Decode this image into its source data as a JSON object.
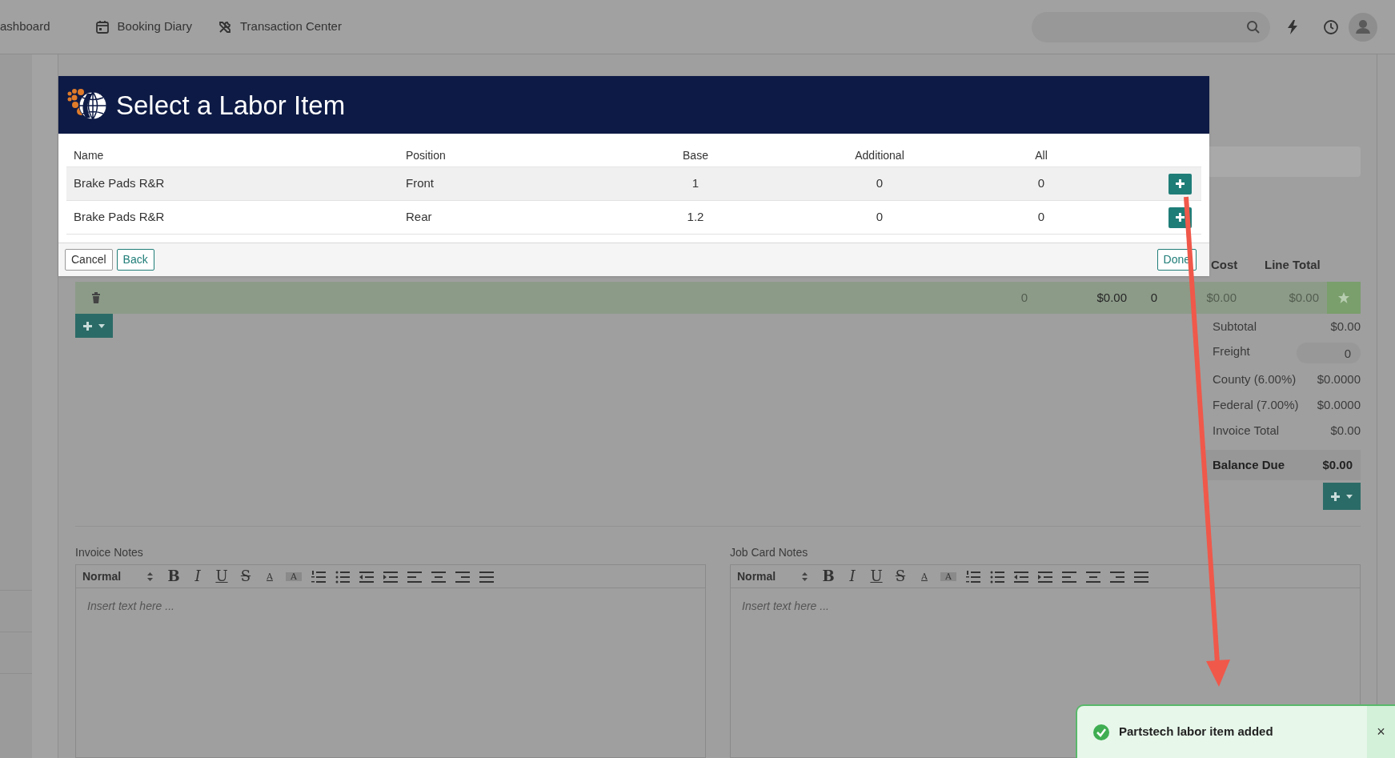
{
  "nav": {
    "items": [
      {
        "label": "ashboard"
      },
      {
        "label": "Booking Diary"
      },
      {
        "label": "Transaction Center"
      }
    ]
  },
  "modal": {
    "title": "Select a Labor Item",
    "columns": [
      "Name",
      "Position",
      "Base",
      "Additional",
      "All"
    ],
    "rows": [
      {
        "name": "Brake Pads R&R",
        "position": "Front",
        "base": "1",
        "additional": "0",
        "all": "0",
        "selected": true
      },
      {
        "name": "Brake Pads R&R",
        "position": "Rear",
        "base": "1.2",
        "additional": "0",
        "all": "0",
        "selected": false
      }
    ],
    "footer_buttons": [
      {
        "label": "Cancel",
        "kind": "secondary"
      },
      {
        "label": "Back",
        "kind": "primary"
      },
      {
        "label": "Done",
        "kind": "primary"
      }
    ]
  },
  "grid": {
    "columns": [
      "Cost",
      "Line Total"
    ],
    "line": {
      "cells": [
        {
          "text": "0",
          "dim": true
        },
        {
          "text": "$0.00",
          "dim": false
        },
        {
          "text": "0",
          "dim": false
        },
        {
          "text": "$0.00",
          "dim": true
        },
        {
          "text": "$0.00",
          "dim": true
        }
      ]
    }
  },
  "totals": [
    {
      "label": "Subtotal",
      "value": "$0.00",
      "kind": "text"
    },
    {
      "label": "Freight",
      "value": "0",
      "kind": "input"
    },
    {
      "label": "County (6.00%)",
      "value": "$0.0000",
      "kind": "text"
    },
    {
      "label": "Federal (7.00%)",
      "value": "$0.0000",
      "kind": "text"
    },
    {
      "label": "Invoice Total",
      "value": "$0.00",
      "kind": "text"
    },
    {
      "label": "Balance Due",
      "value": "$0.00",
      "kind": "strong"
    }
  ],
  "editors": [
    {
      "label": "Invoice Notes",
      "format": "Normal",
      "placeholder": "Insert text here ...",
      "letters": [
        {
          "kind": "bold",
          "label": "B"
        },
        {
          "kind": "italic",
          "label": "I"
        },
        {
          "kind": "underline",
          "label": "U"
        },
        {
          "kind": "strike",
          "label": "S"
        },
        {
          "kind": "color",
          "label": "A"
        },
        {
          "kind": "background",
          "label": "A"
        }
      ]
    },
    {
      "label": "Job Card Notes",
      "format": "Normal",
      "placeholder": "Insert text here ...",
      "letters": [
        {
          "kind": "bold",
          "label": "B"
        },
        {
          "kind": "italic",
          "label": "I"
        },
        {
          "kind": "underline",
          "label": "U"
        },
        {
          "kind": "strike",
          "label": "S"
        },
        {
          "kind": "color",
          "label": "A"
        },
        {
          "kind": "background",
          "label": "A"
        }
      ]
    }
  ],
  "toast": {
    "message": "Partstech labor item added",
    "close": "×"
  }
}
